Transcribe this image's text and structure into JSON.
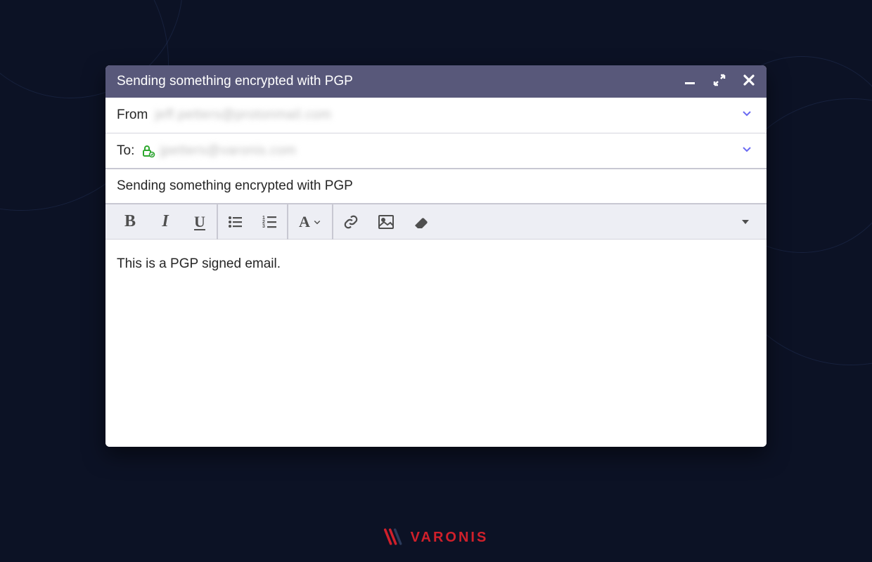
{
  "window": {
    "title": "Sending something encrypted with PGP"
  },
  "fields": {
    "from_label": "From",
    "from_value": "jeff.petters@protonmail.com",
    "to_label": "To:",
    "to_value": "jpetters@varonis.com"
  },
  "subject": "Sending something encrypted with PGP",
  "body": "This is a PGP signed email.",
  "brand": "VARONIS",
  "colors": {
    "titlebar": "#58587a",
    "accent_chev": "#6b6bf2",
    "lock_green": "#2fa82f",
    "brand_red": "#d0202b"
  }
}
